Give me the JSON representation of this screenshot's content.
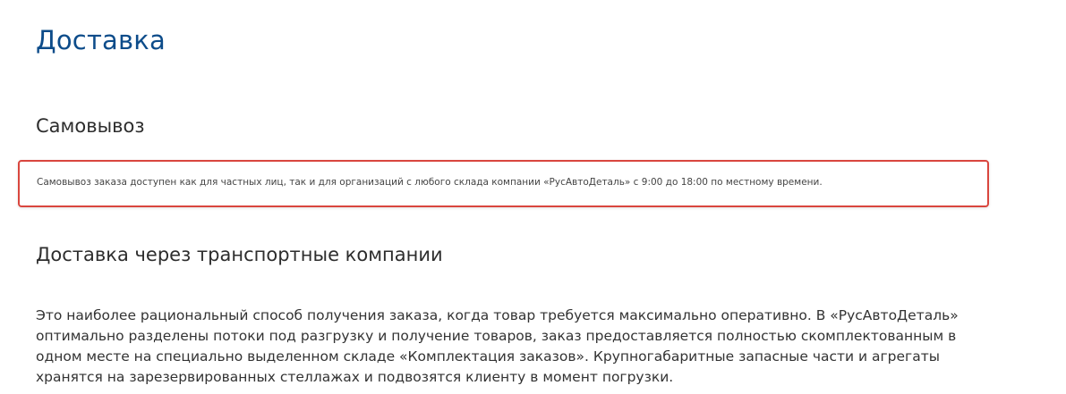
{
  "page": {
    "title": "Доставка"
  },
  "pickup": {
    "heading": "Самовывоз",
    "notice": "Самовывоз заказа доступен как для частных лиц, так и для организаций с любого склада компании «РусАвтоДеталь» с 9:00 до 18:00 по местному времени.",
    "notice_border_color": "#d9463e"
  },
  "transport": {
    "heading": "Доставка через транспортные компании",
    "paragraph_lines": [
      "Это наиболее рациональный способ получения заказа, когда товар требуется максимально оперативно. В «РусАвтоДеталь»",
      "оптимально разделены потоки под разгрузку и получение товаров, заказ предоставляется полностью скомплектованным в",
      "одном месте на специально выделенном складе «Комплектация заказов». Крупногабаритные запасные части и агрегаты",
      "хранятся на зарезервированных стеллажах и подвозятся клиенту в момент погрузки."
    ]
  },
  "colors": {
    "title": "#0d4c8a",
    "text": "#333333"
  }
}
